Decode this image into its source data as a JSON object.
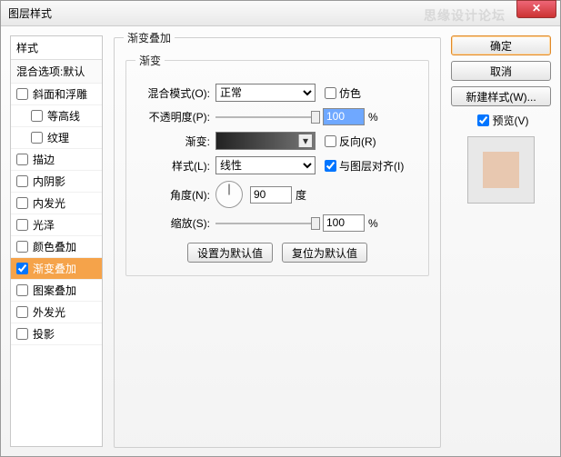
{
  "window": {
    "title": "图层样式"
  },
  "watermark": "思缘设计论坛",
  "sidebar": {
    "head": "样式",
    "sub": "混合选项:默认",
    "items": [
      {
        "label": "斜面和浮雕",
        "checked": false,
        "indent": false
      },
      {
        "label": "等高线",
        "checked": false,
        "indent": true
      },
      {
        "label": "纹理",
        "checked": false,
        "indent": true
      },
      {
        "label": "描边",
        "checked": false,
        "indent": false
      },
      {
        "label": "内阴影",
        "checked": false,
        "indent": false
      },
      {
        "label": "内发光",
        "checked": false,
        "indent": false
      },
      {
        "label": "光泽",
        "checked": false,
        "indent": false
      },
      {
        "label": "颜色叠加",
        "checked": false,
        "indent": false
      },
      {
        "label": "渐变叠加",
        "checked": true,
        "indent": false,
        "selected": true
      },
      {
        "label": "图案叠加",
        "checked": false,
        "indent": false
      },
      {
        "label": "外发光",
        "checked": false,
        "indent": false
      },
      {
        "label": "投影",
        "checked": false,
        "indent": false
      }
    ]
  },
  "panel": {
    "outer_title": "渐变叠加",
    "inner_title": "渐变",
    "blend_label": "混合模式(O):",
    "blend_value": "正常",
    "dither_label": "仿色",
    "dither_checked": false,
    "opacity_label": "不透明度(P):",
    "opacity_value": "100",
    "opacity_unit": "%",
    "gradient_label": "渐变:",
    "reverse_label": "反向(R)",
    "reverse_checked": false,
    "style_label": "样式(L):",
    "style_value": "线性",
    "align_label": "与图层对齐(I)",
    "align_checked": true,
    "angle_label": "角度(N):",
    "angle_value": "90",
    "angle_unit": "度",
    "scale_label": "缩放(S):",
    "scale_value": "100",
    "scale_unit": "%",
    "reset_btn": "设置为默认值",
    "restore_btn": "复位为默认值"
  },
  "right": {
    "ok": "确定",
    "cancel": "取消",
    "newstyle": "新建样式(W)...",
    "preview_label": "预览(V)",
    "preview_checked": true
  }
}
